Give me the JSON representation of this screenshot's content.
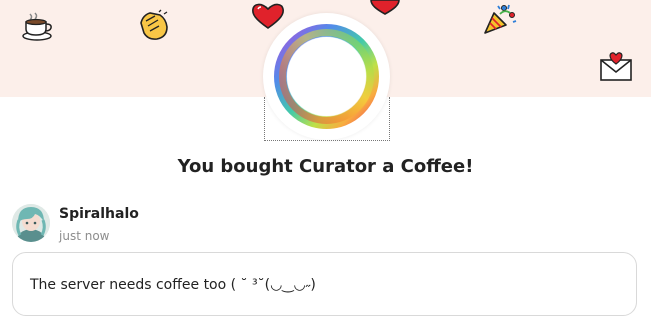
{
  "header": {
    "banner_color": "#fcefea",
    "decorations": [
      "coffee-cup-icon",
      "clapping-hands-icon",
      "heart-icon",
      "heart-icon",
      "party-popper-icon",
      "love-letter-icon"
    ]
  },
  "creator": {
    "avatar_icon": "rainbow-ring-icon"
  },
  "confirmation": {
    "title": "You bought Curator a Coffee!"
  },
  "supporter": {
    "name": "Spiralhalo",
    "time": "just now",
    "avatar_icon": "anime-avatar"
  },
  "message": {
    "text": "The server needs coffee too ( ˘ ³˘(◡‿◡˶)"
  },
  "colors": {
    "accent_red": "#e0222b",
    "text": "#222222",
    "muted": "#8d8d8d",
    "border": "#d9d9d9"
  }
}
